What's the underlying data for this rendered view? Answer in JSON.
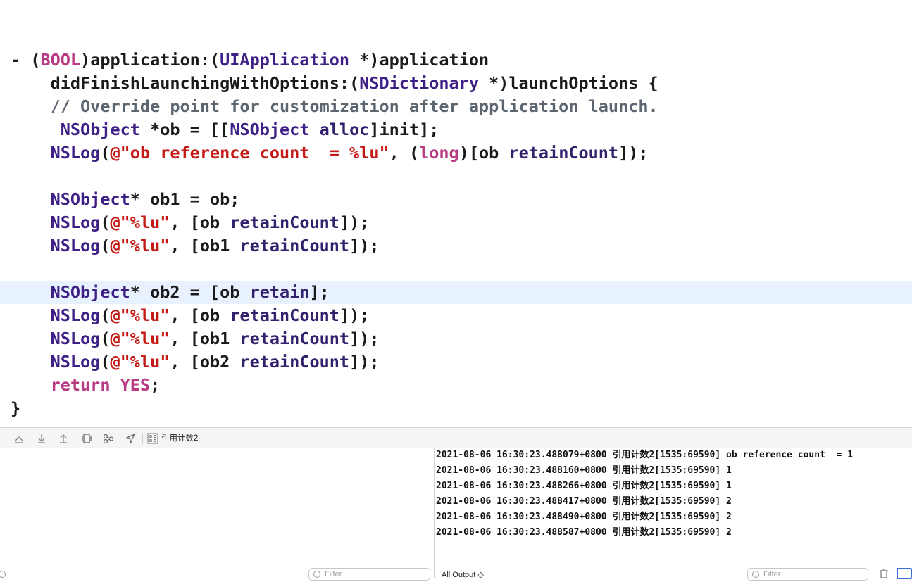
{
  "editor": {
    "lines": [
      [
        [
          "plain",
          "- ("
        ],
        [
          "keyword",
          "BOOL"
        ],
        [
          "plain",
          ")application:("
        ],
        [
          "type",
          "UIApplication"
        ],
        [
          "plain",
          " *)application"
        ]
      ],
      [
        [
          "plain",
          "    didFinishLaunchingWithOptions:("
        ],
        [
          "type",
          "NSDictionary"
        ],
        [
          "plain",
          " *)launchOptions {"
        ]
      ],
      [
        [
          "comment",
          "    // Override point for customization after application launch."
        ]
      ],
      [
        [
          "plain",
          "     "
        ],
        [
          "type",
          "NSObject"
        ],
        [
          "plain",
          " *ob = [["
        ],
        [
          "type",
          "NSObject"
        ],
        [
          "plain",
          " "
        ],
        [
          "method",
          "alloc"
        ],
        [
          "plain",
          "]init];"
        ]
      ],
      [
        [
          "plain",
          "    "
        ],
        [
          "type",
          "NSLog"
        ],
        [
          "plain",
          "("
        ],
        [
          "string",
          "@\"ob reference count  = %lu\""
        ],
        [
          "plain",
          ", ("
        ],
        [
          "keyword",
          "long"
        ],
        [
          "plain",
          ")[ob "
        ],
        [
          "method",
          "retainCount"
        ],
        [
          "plain",
          "]);"
        ]
      ],
      [],
      [
        [
          "plain",
          "    "
        ],
        [
          "type",
          "NSObject"
        ],
        [
          "plain",
          "* ob1 = ob;"
        ]
      ],
      [
        [
          "plain",
          "    "
        ],
        [
          "type",
          "NSLog"
        ],
        [
          "plain",
          "("
        ],
        [
          "string",
          "@\"%lu\""
        ],
        [
          "plain",
          ", [ob "
        ],
        [
          "method",
          "retainCount"
        ],
        [
          "plain",
          "]);"
        ]
      ],
      [
        [
          "plain",
          "    "
        ],
        [
          "type",
          "NSLog"
        ],
        [
          "plain",
          "("
        ],
        [
          "string",
          "@\"%lu\""
        ],
        [
          "plain",
          ", [ob1 "
        ],
        [
          "method",
          "retainCount"
        ],
        [
          "plain",
          "]);"
        ]
      ],
      [],
      [
        [
          "plain",
          "    "
        ],
        [
          "type",
          "NSObject"
        ],
        [
          "plain",
          "* ob2 = [ob "
        ],
        [
          "method",
          "retain"
        ],
        [
          "plain",
          "];"
        ]
      ],
      [
        [
          "plain",
          "    "
        ],
        [
          "type",
          "NSLog"
        ],
        [
          "plain",
          "("
        ],
        [
          "string",
          "@\"%lu\""
        ],
        [
          "plain",
          ", [ob "
        ],
        [
          "method",
          "retainCount"
        ],
        [
          "plain",
          "]);"
        ]
      ],
      [
        [
          "plain",
          "    "
        ],
        [
          "type",
          "NSLog"
        ],
        [
          "plain",
          "("
        ],
        [
          "string",
          "@\"%lu\""
        ],
        [
          "plain",
          ", [ob1 "
        ],
        [
          "method",
          "retainCount"
        ],
        [
          "plain",
          "]);"
        ]
      ],
      [
        [
          "plain",
          "    "
        ],
        [
          "type",
          "NSLog"
        ],
        [
          "plain",
          "("
        ],
        [
          "string",
          "@\"%lu\""
        ],
        [
          "plain",
          ", [ob2 "
        ],
        [
          "method",
          "retainCount"
        ],
        [
          "plain",
          "]);"
        ]
      ],
      [
        [
          "plain",
          "    "
        ],
        [
          "keyword",
          "return"
        ],
        [
          "plain",
          " "
        ],
        [
          "keyword",
          "YES"
        ],
        [
          "plain",
          ";"
        ]
      ],
      [
        [
          "plain",
          "}"
        ]
      ]
    ],
    "current_line_index": 10
  },
  "debug_bar": {
    "target_label": "引用计数2",
    "buttons": [
      "hide-debug-area-icon",
      "step-over-icon",
      "step-in-icon",
      "step-out-icon",
      "debug-view-hierarchy-icon",
      "memory-graph-icon",
      "simulate-location-icon",
      "target-icon"
    ]
  },
  "console": {
    "lines": [
      "2021-08-06 16:30:23.488079+0800 引用计数2[1535:69590] ob reference count  = 1",
      "2021-08-06 16:30:23.488160+0800 引用计数2[1535:69590] 1",
      "2021-08-06 16:30:23.488266+0800 引用计数2[1535:69590] 1",
      "2021-08-06 16:30:23.488417+0800 引用计数2[1535:69590] 2",
      "2021-08-06 16:30:23.488490+0800 引用计数2[1535:69590] 2",
      "2021-08-06 16:30:23.488587+0800 引用计数2[1535:69590] 2"
    ],
    "caret_line_index": 2,
    "output_select": "All Output ◇",
    "filter_placeholder": "Filter"
  },
  "variables": {
    "filter_placeholder": "Filter"
  }
}
